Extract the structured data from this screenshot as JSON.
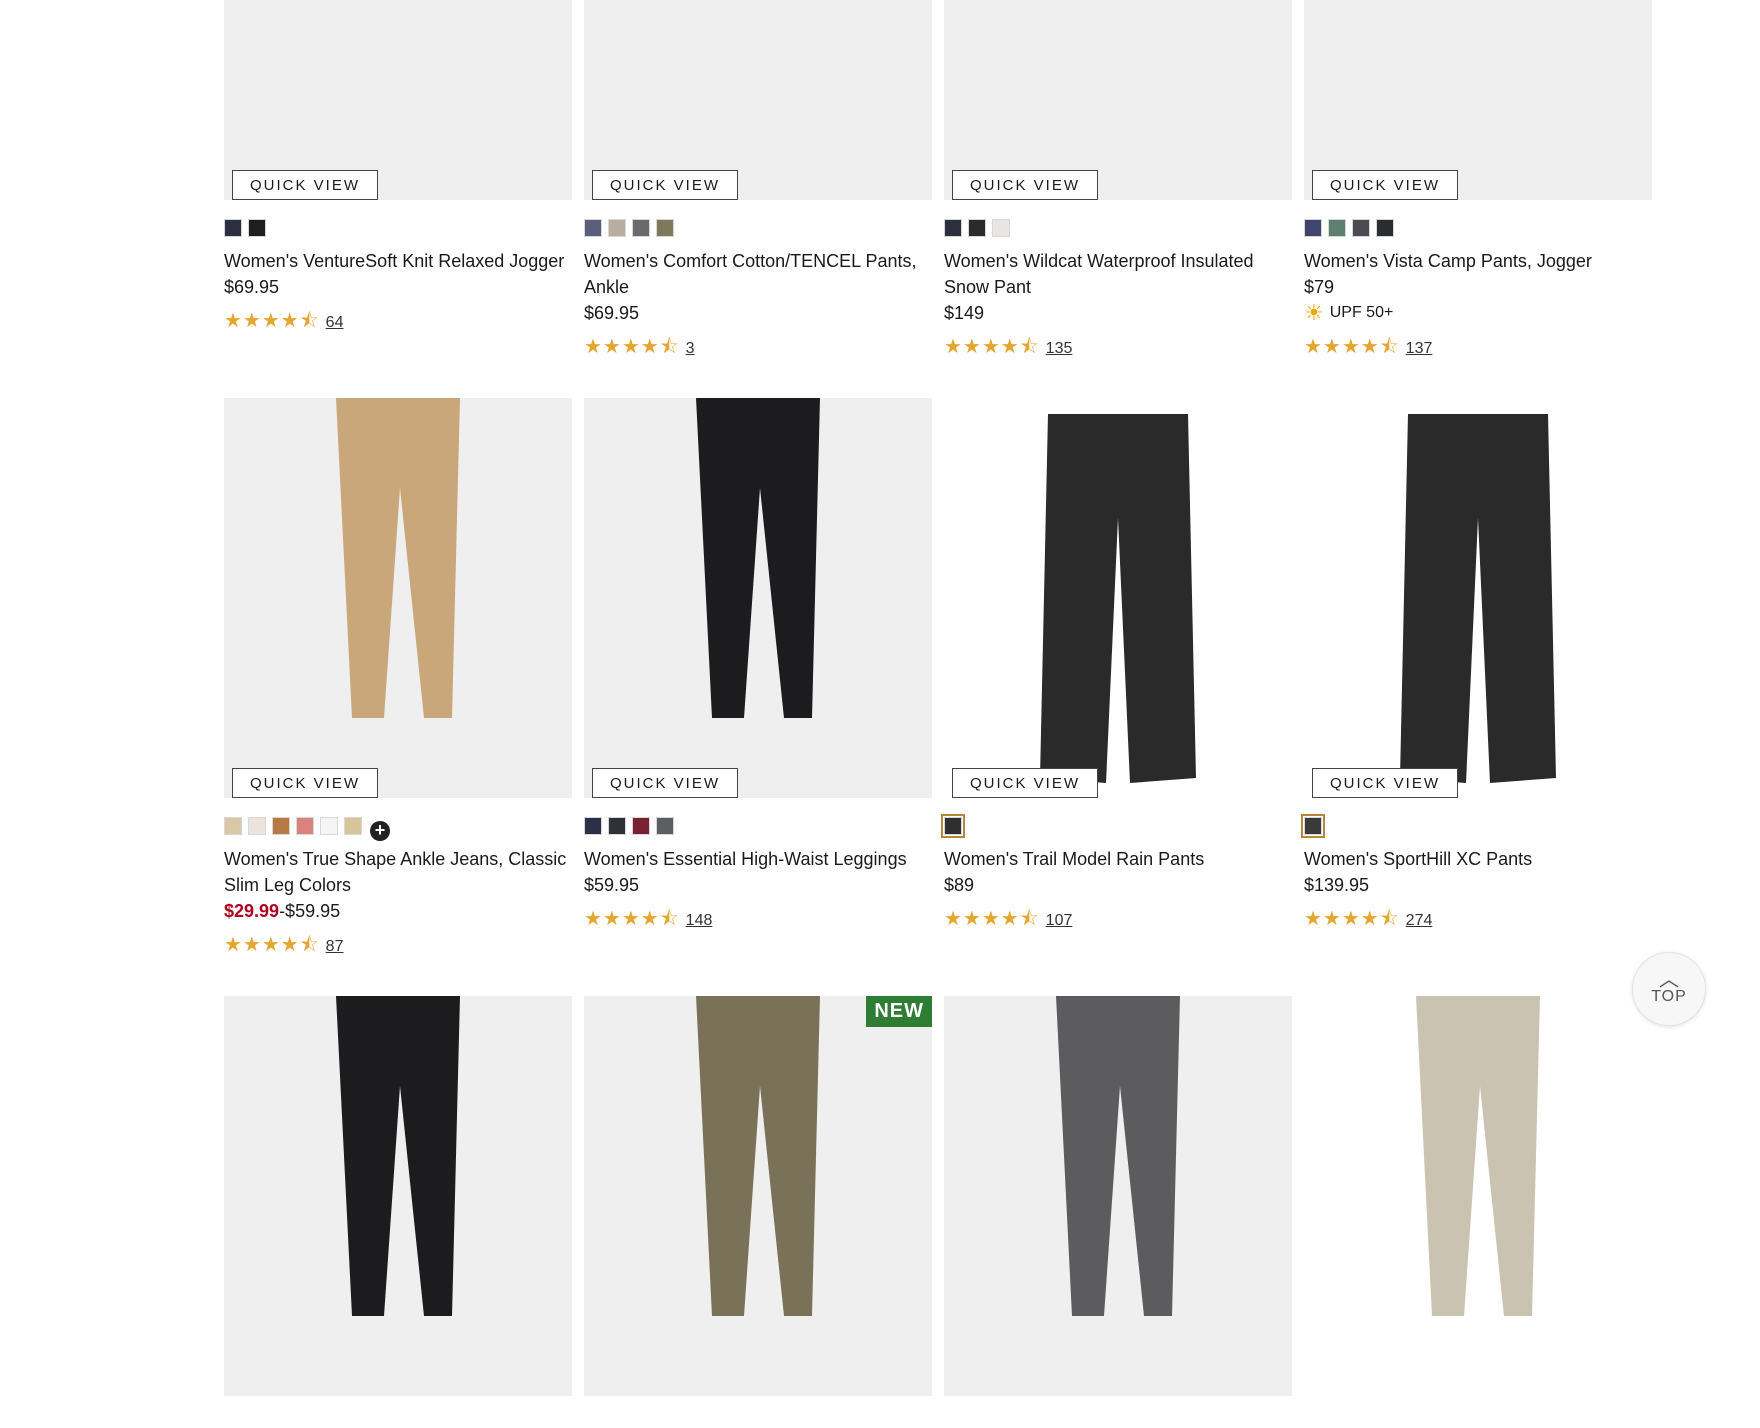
{
  "quick_view_label": "QUICK VIEW",
  "new_badge": "NEW",
  "top_button_label": "TOP",
  "rows": [
    {
      "products": [
        {
          "name": "Women's VentureSoft Knit Relaxed Jogger",
          "price": "$69.95",
          "rating_value": 4.5,
          "review_count": "64",
          "swatches": [
            "#2b2f3f",
            "#1e1e1e"
          ],
          "image_bg": "#efefef"
        },
        {
          "name": "Women's Comfort Cotton/TENCEL Pants, Ankle",
          "price": "$69.95",
          "rating_value": 4.5,
          "review_count": "3",
          "swatches": [
            "#5a5f7e",
            "#b8ada0",
            "#6a6a6e",
            "#7c7a5a"
          ],
          "image_bg": "#efefef"
        },
        {
          "name": "Women's Wildcat Waterproof Insulated Snow Pant",
          "price": "$149",
          "rating_value": 4.5,
          "review_count": "135",
          "swatches": [
            "#2c2f3d",
            "#2a2a2a",
            "#e8e6e2"
          ],
          "image_bg": "#efefef"
        },
        {
          "name": "Women's Vista Camp Pants, Jogger",
          "price": "$79",
          "upf_label": "UPF 50+",
          "rating_value": 4.5,
          "review_count": "137",
          "swatches": [
            "#3e4670",
            "#5f7f72",
            "#4a4c52",
            "#2a2c30"
          ],
          "image_bg": "#efefef"
        }
      ]
    },
    {
      "products": [
        {
          "name": "Women's True Shape Ankle Jeans, Classic Slim Leg Colors",
          "price_sale": "$29.99",
          "price_regular": "-$59.95",
          "rating_value": 4.5,
          "review_count": "87",
          "swatches": [
            "#d8c8a6",
            "#ece3dc",
            "#b87a43",
            "#d9837c",
            "#f5f5f5",
            "#d8c49b"
          ],
          "more_colors": true,
          "image_bg": "#efefef",
          "garment": "khaki"
        },
        {
          "name": "Women's Essential High-Waist Leggings",
          "price": "$59.95",
          "rating_value": 4.5,
          "review_count": "148",
          "swatches": [
            "#2b2f47",
            "#2f3138",
            "#7a2233",
            "#5d5e62"
          ],
          "image_bg": "#efefef",
          "garment": "black"
        },
        {
          "name": "Women's Trail Model Rain Pants",
          "price": "$89",
          "rating_value": 4.5,
          "review_count": "107",
          "swatches": [
            "#2f2f2f"
          ],
          "selected_swatch": 0,
          "image_bg": "#ffffff",
          "garment": "flat"
        },
        {
          "name": "Women's SportHill XC Pants",
          "price": "$139.95",
          "rating_value": 4.5,
          "review_count": "274",
          "swatches": [
            "#3a3a3a"
          ],
          "selected_swatch": 0,
          "image_bg": "#ffffff",
          "garment": "flat"
        }
      ]
    },
    {
      "products": [
        {
          "image_bg": "#efefef",
          "garment": "black"
        },
        {
          "image_bg": "#efefef",
          "garment": "olive",
          "is_new": true
        },
        {
          "image_bg": "#efefef",
          "garment": "grey"
        },
        {
          "image_bg": "#ffffff",
          "garment": "stone"
        }
      ]
    }
  ]
}
